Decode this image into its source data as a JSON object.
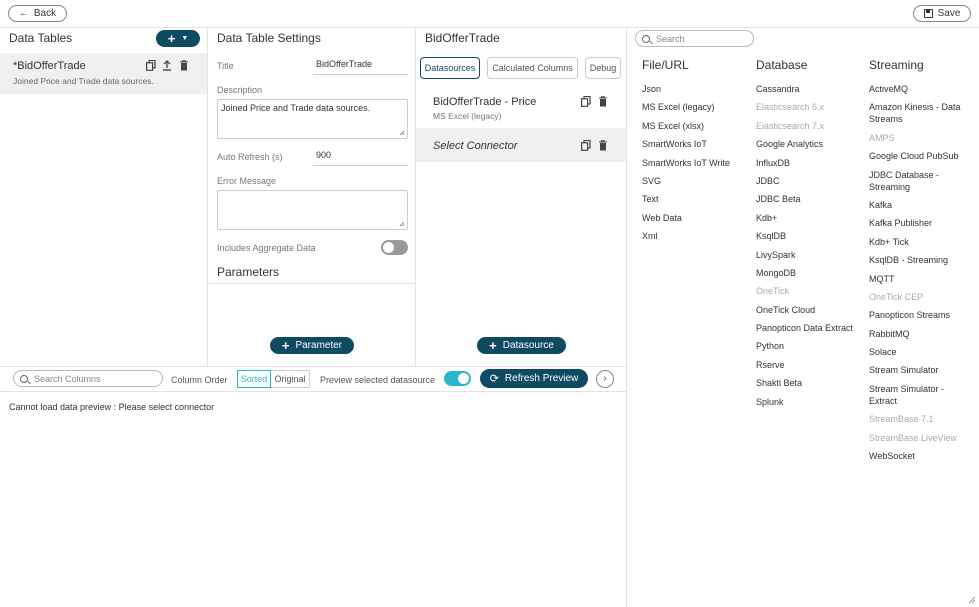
{
  "topbar": {
    "back_label": "Back",
    "save_label": "Save"
  },
  "data_tables": {
    "title": "Data Tables",
    "item": {
      "name": "*BidOfferTrade",
      "description": "Joined Price and Trade data sources."
    }
  },
  "settings": {
    "title": "Data Table Settings",
    "title_label": "Title",
    "title_value": "BidOfferTrade",
    "description_label": "Description",
    "description_value": "Joined Price and Trade data sources.",
    "auto_refresh_label": "Auto Refresh (s)",
    "auto_refresh_value": "900",
    "error_label": "Error Message",
    "error_value": "",
    "aggregate_label": "Includes Aggregate Data",
    "aggregate_on": false,
    "parameters_title": "Parameters",
    "add_parameter_label": "Parameter"
  },
  "datasources": {
    "title": "BidOfferTrade",
    "tabs": [
      "Datasources",
      "Calculated Columns",
      "Debug"
    ],
    "items": [
      {
        "name": "BidOfferTrade - Price",
        "sub": "MS Excel (legacy)"
      },
      {
        "name": "Select Connector"
      }
    ],
    "add_label": "Datasource"
  },
  "connectors": {
    "search_placeholder": "Search",
    "columns": [
      {
        "title": "File/URL",
        "items": [
          {
            "label": "Json"
          },
          {
            "label": "MS Excel (legacy)"
          },
          {
            "label": "MS Excel (xlsx)"
          },
          {
            "label": "SmartWorks IoT"
          },
          {
            "label": "SmartWorks IoT Write"
          },
          {
            "label": "SVG"
          },
          {
            "label": "Text"
          },
          {
            "label": "Web Data"
          },
          {
            "label": "Xml"
          }
        ]
      },
      {
        "title": "Database",
        "items": [
          {
            "label": "Cassandra"
          },
          {
            "label": "Elasticsearch 6.x",
            "disabled": true
          },
          {
            "label": "Elasticsearch 7.x",
            "disabled": true
          },
          {
            "label": "Google Analytics"
          },
          {
            "label": "InfluxDB"
          },
          {
            "label": "JDBC"
          },
          {
            "label": "JDBC Beta"
          },
          {
            "label": "Kdb+"
          },
          {
            "label": "KsqlDB"
          },
          {
            "label": "LivySpark"
          },
          {
            "label": "MongoDB"
          },
          {
            "label": "OneTick",
            "disabled": true
          },
          {
            "label": "OneTick Cloud"
          },
          {
            "label": "Panopticon Data Extract"
          },
          {
            "label": "Python"
          },
          {
            "label": "Rserve"
          },
          {
            "label": "Shakti Beta"
          },
          {
            "label": "Splunk"
          }
        ]
      },
      {
        "title": "Streaming",
        "items": [
          {
            "label": "ActiveMQ"
          },
          {
            "label": "Amazon Kinesis - Data Streams"
          },
          {
            "label": "AMPS",
            "disabled": true
          },
          {
            "label": "Google Cloud PubSub"
          },
          {
            "label": "JDBC Database - Streaming"
          },
          {
            "label": "Kafka"
          },
          {
            "label": "Kafka Publisher"
          },
          {
            "label": "Kdb+ Tick"
          },
          {
            "label": "KsqlDB - Streaming"
          },
          {
            "label": "MQTT"
          },
          {
            "label": "OneTick CEP",
            "disabled": true
          },
          {
            "label": "Panopticon Streams"
          },
          {
            "label": "RabbitMQ"
          },
          {
            "label": "Solace"
          },
          {
            "label": "Stream Simulator"
          },
          {
            "label": "Stream Simulator - Extract"
          },
          {
            "label": "StreamBase 7.1",
            "disabled": true
          },
          {
            "label": "StreamBase LiveView",
            "disabled": true
          },
          {
            "label": "WebSocket"
          }
        ]
      }
    ]
  },
  "preview": {
    "search_placeholder": "Search Columns",
    "column_order_label": "Column Order",
    "order_options": [
      "Sorted",
      "Original"
    ],
    "order_selected": "Sorted",
    "preview_selected_label": "Preview selected datasource",
    "preview_selected_on": true,
    "refresh_label": "Refresh Preview",
    "message": "Cannot load data preview : Please select connector"
  },
  "colors": {
    "accent": "#0f4a63",
    "teal": "#2bb5c9",
    "toggle_off": "#9a9a9a",
    "selected_bg": "#f0f0f0"
  }
}
